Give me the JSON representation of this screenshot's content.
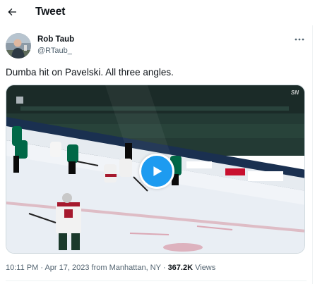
{
  "header": {
    "title": "Tweet",
    "back_icon": "arrow-left-icon"
  },
  "author": {
    "name": "Rob Taub",
    "handle": "@RTaub_"
  },
  "more_icon": "more-horizontal-icon",
  "tweet": {
    "text": "Dumba hit on Pavelski. All three angles."
  },
  "media": {
    "type": "video",
    "watermark": "SN",
    "play_icon": "play-icon",
    "accent": "#1d9bf0"
  },
  "meta": {
    "time": "10:11 PM",
    "date": "Apr 17, 2023",
    "location": "from Manhattan, NY",
    "views_count": "367.2K",
    "views_label": "Views",
    "separator": "·"
  },
  "colors": {
    "text": "#0f1419",
    "secondary": "#536471",
    "brand": "#1d9bf0",
    "border": "#eff3f4"
  }
}
